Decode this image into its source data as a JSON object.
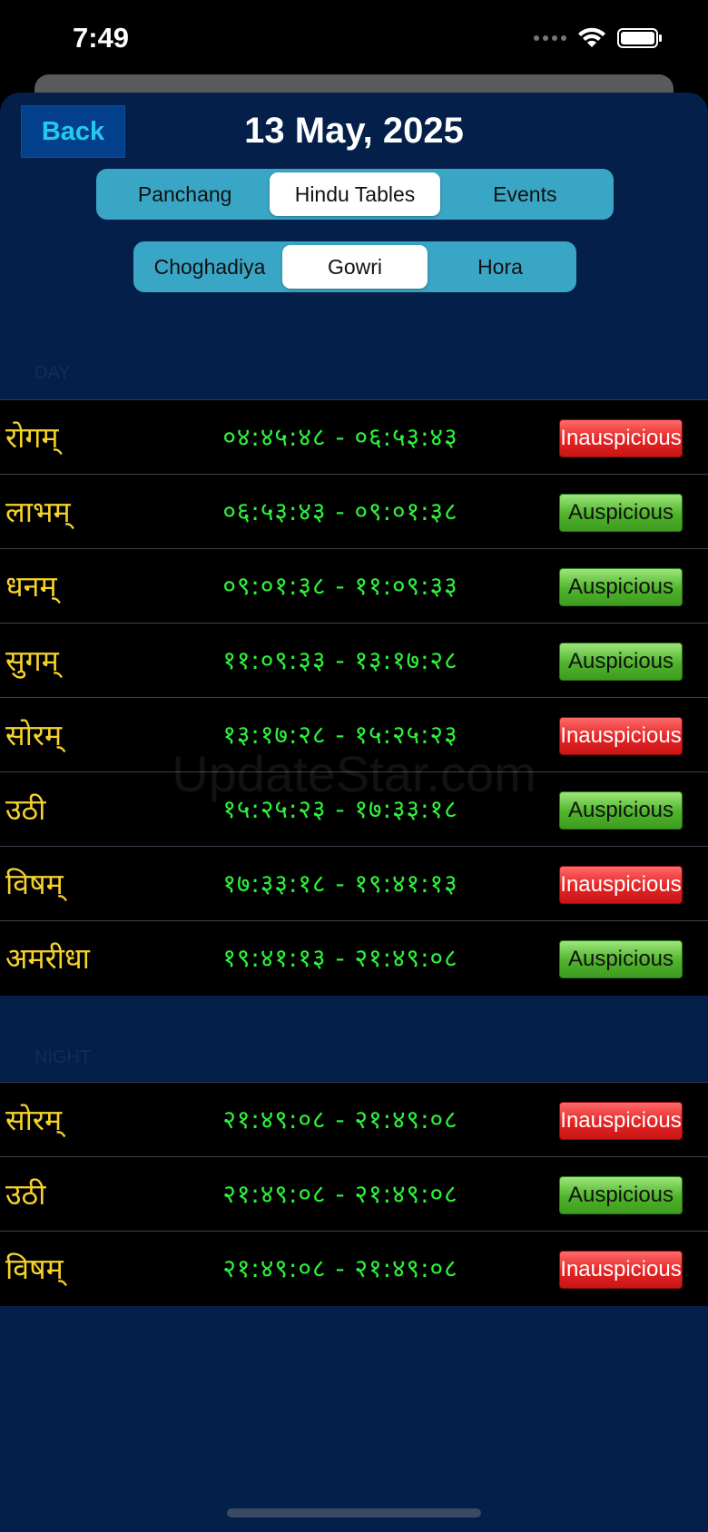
{
  "status_bar": {
    "time": "7:49"
  },
  "header": {
    "back_label": "Back",
    "date": "13 May, 2025"
  },
  "main_tabs": [
    {
      "label": "Panchang",
      "selected": false
    },
    {
      "label": "Hindu Tables",
      "selected": true
    },
    {
      "label": "Events",
      "selected": false
    }
  ],
  "sub_tabs": [
    {
      "label": "Choghadiya",
      "selected": false
    },
    {
      "label": "Gowri",
      "selected": true
    },
    {
      "label": "Hora",
      "selected": false
    }
  ],
  "day": {
    "label": "DAY",
    "rows": [
      {
        "name": "रोगम्",
        "time": "०४:४५:४८ - ०६:५३:४३",
        "status": "Inauspicious",
        "good": false
      },
      {
        "name": "लाभम्",
        "time": "०६:५३:४३ - ०९:०१:३८",
        "status": "Auspicious",
        "good": true
      },
      {
        "name": "धनम्",
        "time": "०९:०१:३८ - ११:०९:३३",
        "status": "Auspicious",
        "good": true
      },
      {
        "name": "सुगम्",
        "time": "११:०९:३३ - १३:१७:२८",
        "status": "Auspicious",
        "good": true
      },
      {
        "name": "सोरम्",
        "time": "१३:१७:२८ - १५:२५:२३",
        "status": "Inauspicious",
        "good": false
      },
      {
        "name": "उठी",
        "time": "१५:२५:२३ - १७:३३:१८",
        "status": "Auspicious",
        "good": true
      },
      {
        "name": "विषम्",
        "time": "१७:३३:१८ - १९:४१:१३",
        "status": "Inauspicious",
        "good": false
      },
      {
        "name": "अमरीधा",
        "time": "१९:४१:१३ - २१:४९:०८",
        "status": "Auspicious",
        "good": true
      }
    ]
  },
  "night": {
    "label": "NIGHT",
    "rows": [
      {
        "name": "सोरम्",
        "time": "२१:४९:०८ - २१:४९:०८",
        "status": "Inauspicious",
        "good": false
      },
      {
        "name": "उठी",
        "time": "२१:४९:०८ - २१:४९:०८",
        "status": "Auspicious",
        "good": true
      },
      {
        "name": "विषम्",
        "time": "२१:४९:०८ - २१:४९:०८",
        "status": "Inauspicious",
        "good": false
      }
    ]
  },
  "watermark": "UpdateStar.com"
}
